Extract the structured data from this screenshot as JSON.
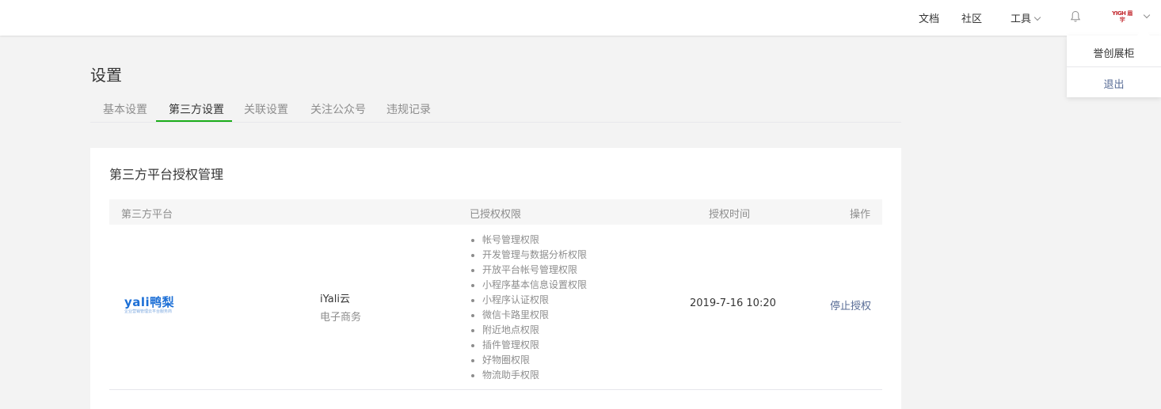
{
  "topbar": {
    "docs": "文档",
    "community": "社区",
    "tools": "工具",
    "avatar_text": "YIGH 眉宇",
    "bell_icon": "bell-icon"
  },
  "dropdown": {
    "account_name": "誉创展柜",
    "logout": "退出"
  },
  "page": {
    "title": "设置"
  },
  "tabs": [
    {
      "label": "基本设置"
    },
    {
      "label": "第三方设置"
    },
    {
      "label": "关联设置"
    },
    {
      "label": "关注公众号"
    },
    {
      "label": "违规记录"
    }
  ],
  "active_tab": "第三方设置",
  "card": {
    "title": "第三方平台授权管理",
    "columns": {
      "platform": "第三方平台",
      "permissions": "已授权权限",
      "time": "授权时间",
      "action": "操作"
    },
    "rows": [
      {
        "logo_brand": "yali鸭梨",
        "logo_tag": "企业营销管理云平台服务商",
        "name": "iYali云",
        "category": "电子商务",
        "permissions": [
          "帐号管理权限",
          "开发管理与数据分析权限",
          "开放平台帐号管理权限",
          "小程序基本信息设置权限",
          "小程序认证权限",
          "微信卡路里权限",
          "附近地点权限",
          "插件管理权限",
          "好物圈权限",
          "物流助手权限"
        ],
        "auth_time": "2019-7-16 10:20",
        "action_label": "停止授权"
      }
    ]
  },
  "colors": {
    "accent": "#1aad19",
    "link": "#576b95",
    "text": "#353535",
    "muted": "#8d8d8d",
    "background": "#f3f3f3"
  }
}
